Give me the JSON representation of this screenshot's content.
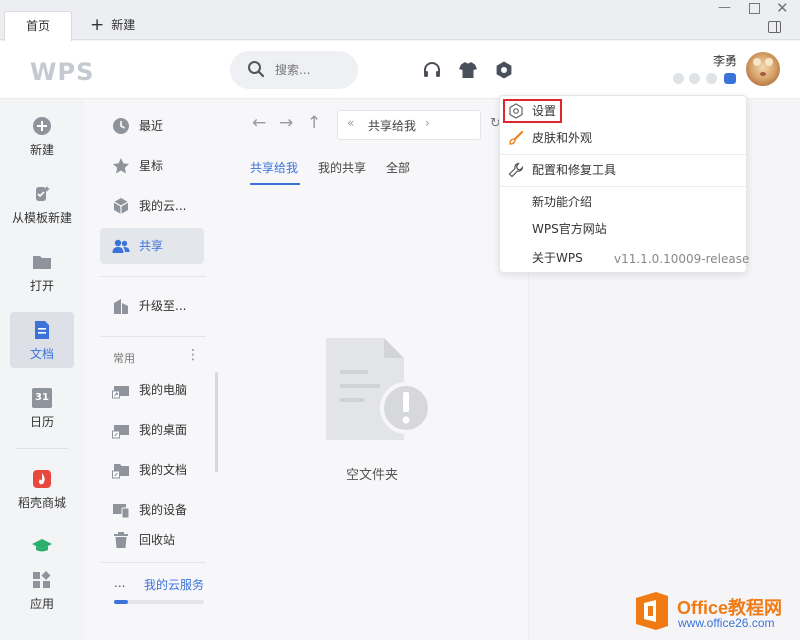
{
  "tabs": {
    "home": "首页",
    "new_tab": "新建"
  },
  "header": {
    "logo": "WPS",
    "search_placeholder": "搜索...",
    "username": "李勇"
  },
  "leftnav": {
    "items": [
      {
        "label": "新建"
      },
      {
        "label": "从模板新建"
      },
      {
        "label": "打开"
      },
      {
        "label": "文档"
      },
      {
        "label": "日历"
      },
      {
        "label": "稻壳商城"
      },
      {
        "label": "应用"
      }
    ],
    "calendar_day": "31"
  },
  "col2": {
    "items": [
      {
        "label": "最近"
      },
      {
        "label": "星标"
      },
      {
        "label": "我的云..."
      },
      {
        "label": "共享"
      },
      {
        "label": "升级至..."
      }
    ],
    "section_title": "常用",
    "common": [
      {
        "label": "我的电脑"
      },
      {
        "label": "我的桌面"
      },
      {
        "label": "我的文档"
      },
      {
        "label": "我的设备"
      },
      {
        "label": "回收站"
      }
    ],
    "cloud_ellipsis": "...",
    "cloud_service": "我的云服务",
    "cloud_usage_fraction": 0.15
  },
  "main": {
    "breadcrumb": "共享给我",
    "tabs": [
      "共享给我",
      "我的共享",
      "全部"
    ],
    "empty_text": "空文件夹"
  },
  "menu": {
    "items": [
      {
        "label": "设置"
      },
      {
        "label": "皮肤和外观"
      },
      {
        "label": "配置和修复工具"
      },
      {
        "label": "新功能介绍"
      },
      {
        "label": "WPS官方网站"
      },
      {
        "label": "关于WPS"
      }
    ],
    "version": "v11.1.0.10009-release"
  },
  "watermark": {
    "brand": "Office教程网",
    "url": "www.office26.com"
  },
  "colors": {
    "accent": "#3b73d9",
    "highlight": "#e0262b",
    "brand_orange": "#f07b14"
  }
}
